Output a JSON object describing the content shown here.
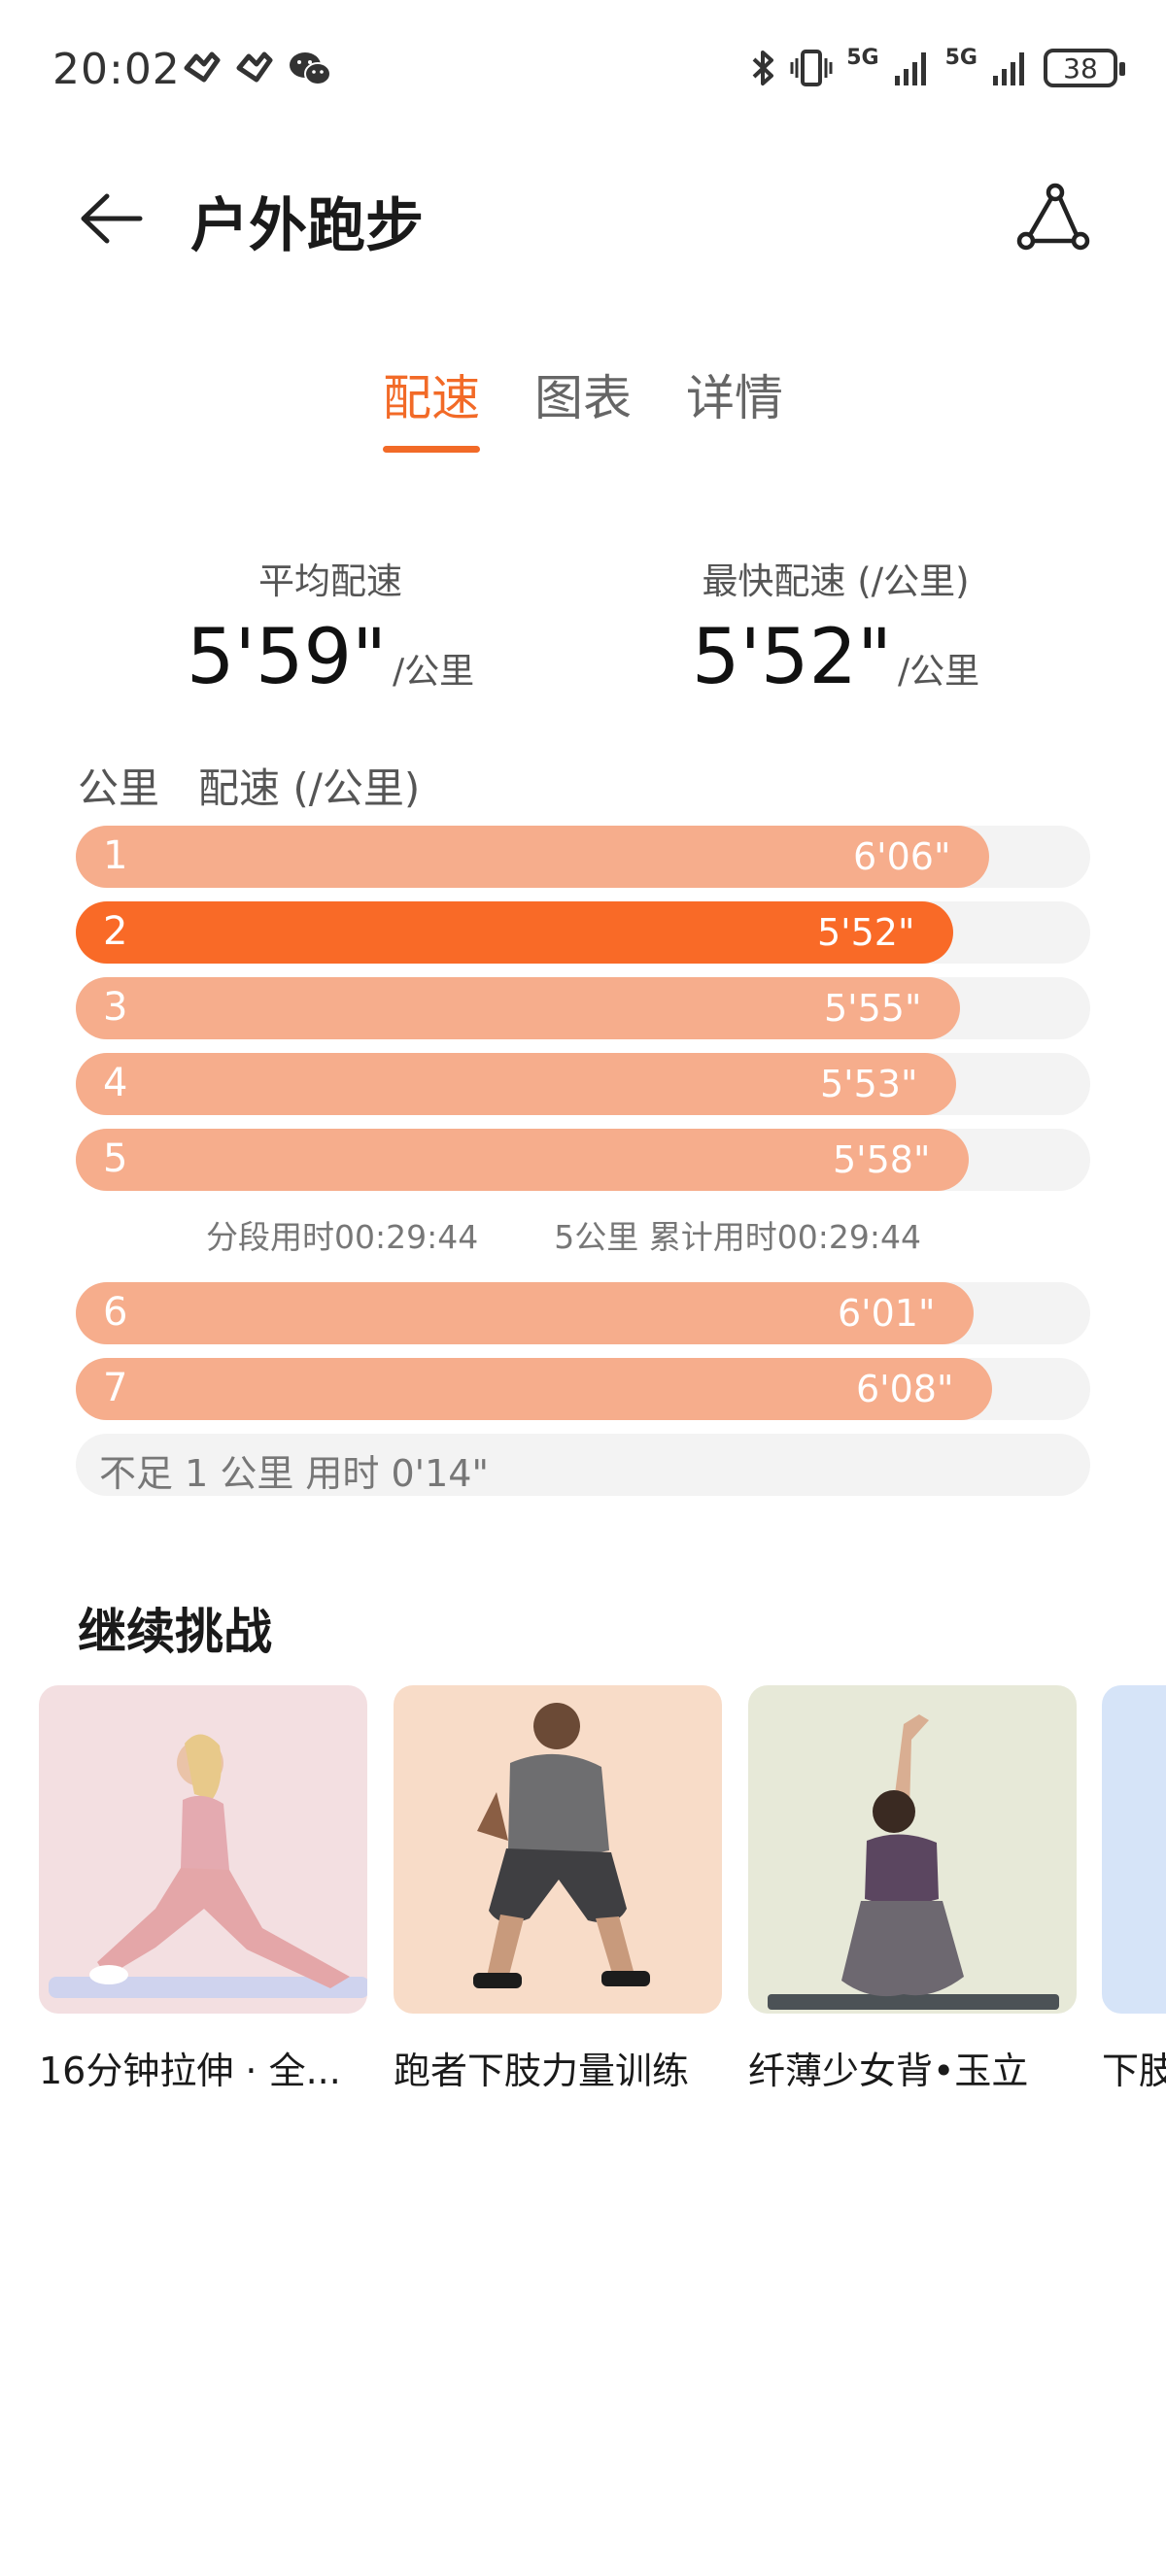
{
  "status_bar": {
    "time": "20:02",
    "network_a": "5G",
    "network_b": "5G",
    "battery": "38",
    "icons": [
      "huawei-health-icon",
      "huawei-health-icon",
      "wechat-icon",
      "bluetooth-icon",
      "vibrate-icon",
      "signal-icon",
      "signal-icon"
    ]
  },
  "header": {
    "title": "户外跑步",
    "back_icon": "back-arrow-icon",
    "share_icon": "share-route-icon"
  },
  "tabs": [
    {
      "label": "配速",
      "active": true
    },
    {
      "label": "图表",
      "active": false
    },
    {
      "label": "详情",
      "active": false
    }
  ],
  "summary": {
    "avg_label": "平均配速",
    "avg_value": "5'59\"",
    "avg_unit": "/公里",
    "fast_label": "最快配速 (/公里)",
    "fast_value": "5'52\"",
    "fast_unit": "/公里"
  },
  "pace_table": {
    "col_km": "公里",
    "col_pace": "配速 (/公里)",
    "rows": [
      {
        "km": "1",
        "pace": "6'06\"",
        "fill": 0.9
      },
      {
        "km": "2",
        "pace": "5'52\"",
        "fill": 0.865,
        "fastest": true
      },
      {
        "km": "3",
        "pace": "5'55\"",
        "fill": 0.872
      },
      {
        "km": "4",
        "pace": "5'53\"",
        "fill": 0.868
      },
      {
        "km": "5",
        "pace": "5'58\"",
        "fill": 0.88
      }
    ],
    "split_time": "分段用时00:29:44",
    "cumulative_time": "5公里 累计用时00:29:44",
    "rows_after": [
      {
        "km": "6",
        "pace": "6'01\"",
        "fill": 0.885
      },
      {
        "km": "7",
        "pace": "6'08\"",
        "fill": 0.903
      }
    ],
    "remainder": "不足 1 公里 用时 0'14\""
  },
  "challenge": {
    "title": "继续挑战",
    "cards": [
      {
        "title": "16分钟拉伸 · 全...",
        "bg": "#f3dfe1"
      },
      {
        "title": "跑者下肢力量训练",
        "bg": "#f8dcc8"
      },
      {
        "title": "纤薄少女背•玉立",
        "bg": "#e7e9d8"
      },
      {
        "title": "下肢",
        "bg": "#d6e4f8"
      }
    ]
  },
  "colors": {
    "accent": "#f26a27",
    "bar_light": "#f6ad8c",
    "bar_fastest": "#f96a27",
    "track": "#f3f3f3"
  }
}
